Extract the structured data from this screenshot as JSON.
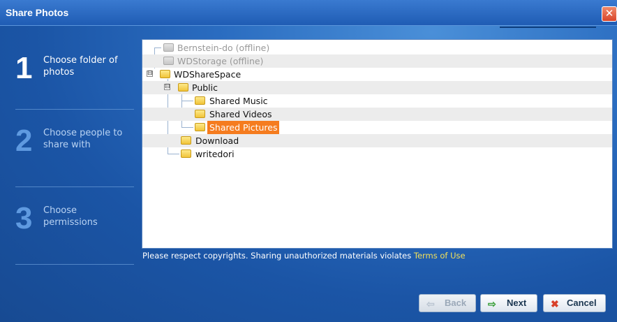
{
  "window": {
    "title": "Share Photos",
    "close_glyph": "✕"
  },
  "steps": [
    {
      "number": "1",
      "label": "Choose folder of photos",
      "active": true
    },
    {
      "number": "2",
      "label": "Choose people to share with",
      "active": false
    },
    {
      "number": "3",
      "label": "Choose permissions",
      "active": false
    }
  ],
  "tree": {
    "items": [
      {
        "label": "Bernstein-do (offline)",
        "icon": "folder-offline-icon"
      },
      {
        "label": "WDStorage (offline)",
        "icon": "folder-offline-icon"
      },
      {
        "label": "WDShareSpace",
        "icon": "folder-icon",
        "expander": "⊟"
      },
      {
        "label": "Public",
        "icon": "folder-icon",
        "expander": "⊟"
      },
      {
        "label": "Shared Music",
        "icon": "folder-icon"
      },
      {
        "label": "Shared Videos",
        "icon": "folder-icon"
      },
      {
        "label": "Shared Pictures",
        "icon": "folder-icon",
        "selected": true
      },
      {
        "label": "Download",
        "icon": "folder-icon"
      },
      {
        "label": "writedori",
        "icon": "folder-icon"
      }
    ],
    "selected_color": "#f57c1f"
  },
  "footer": {
    "notice": "Please respect copyrights. Sharing unauthorized materials violates",
    "terms_link": "Terms of Use"
  },
  "buttons": {
    "back": {
      "label": "Back",
      "icon": "arrow-left-icon",
      "glyph": "⇦",
      "enabled": false
    },
    "next": {
      "label": "Next",
      "icon": "arrow-right-icon",
      "glyph": "⇨",
      "enabled": true
    },
    "cancel": {
      "label": "Cancel",
      "icon": "cancel-x-icon",
      "glyph": "✖",
      "enabled": true
    }
  },
  "colors": {
    "background": "#1f5cb4",
    "link": "#f2e05a"
  }
}
